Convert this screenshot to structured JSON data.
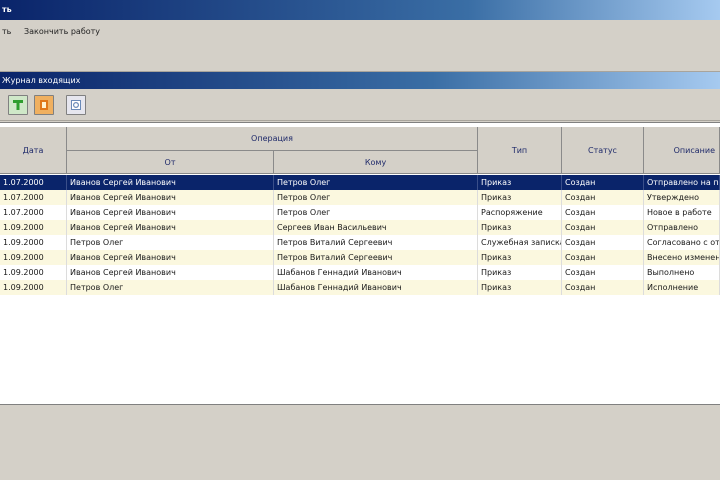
{
  "window": {
    "title": "ть"
  },
  "menu": {
    "item1": "ть",
    "item2": "Закончить работу"
  },
  "subwindow": {
    "title": "Журнал входящих"
  },
  "toolbar": {
    "buttons": [
      {
        "icon": "add-icon",
        "color": "#2e9e2e"
      },
      {
        "icon": "delete-icon",
        "color": "#e0781a"
      },
      {
        "icon": "preview-icon",
        "color": "#6a8ab8"
      }
    ]
  },
  "table": {
    "headers": {
      "date": "Дата",
      "group": "Операция",
      "from": "От",
      "to": "Кому",
      "type": "Тип",
      "status": "Статус",
      "desc": "Описание"
    },
    "rows": [
      {
        "date": "1.07.2000",
        "from": "Иванов Сергей Иванович",
        "to": "Петров Олег",
        "type": "Приказ",
        "status": "Создан",
        "desc": "Отправлено на подпись"
      },
      {
        "date": "1.07.2000",
        "from": "Иванов Сергей Иванович",
        "to": "Петров Олег",
        "type": "Приказ",
        "status": "Создан",
        "desc": "Утверждено"
      },
      {
        "date": "1.07.2000",
        "from": "Иванов Сергей Иванович",
        "to": "Петров Олег",
        "type": "Распоряжение",
        "status": "Создан",
        "desc": "Новое в работе"
      },
      {
        "date": "1.09.2000",
        "from": "Иванов Сергей Иванович",
        "to": "Сергеев Иван Васильевич",
        "type": "Приказ",
        "status": "Создан",
        "desc": "Отправлено"
      },
      {
        "date": "1.09.2000",
        "from": "Петров Олег",
        "to": "Петров Виталий Сергеевич",
        "type": "Служебная записка",
        "status": "Создан",
        "desc": "Согласовано с отделом"
      },
      {
        "date": "1.09.2000",
        "from": "Иванов Сергей Иванович",
        "to": "Петров Виталий Сергеевич",
        "type": "Приказ",
        "status": "Создан",
        "desc": "Внесено изменение"
      },
      {
        "date": "1.09.2000",
        "from": "Иванов Сергей Иванович",
        "to": "Шабанов Геннадий Иванович",
        "type": "Приказ",
        "status": "Создан",
        "desc": "Выполнено"
      },
      {
        "date": "1.09.2000",
        "from": "Петров Олег",
        "to": "Шабанов Геннадий Иванович",
        "type": "Приказ",
        "status": "Создан",
        "desc": "Исполнение"
      }
    ]
  }
}
